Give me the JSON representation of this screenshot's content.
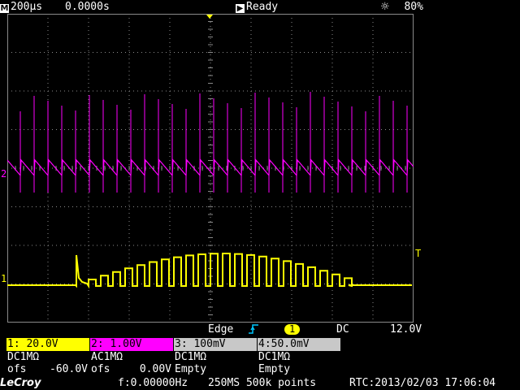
{
  "status": {
    "timebase": "200µs",
    "delay": "0.0000s",
    "run_state": "Ready",
    "brightness": "80%"
  },
  "trigger": {
    "type": "Edge",
    "source": "1",
    "coupling": "DC",
    "level": "12.0V"
  },
  "channels": [
    {
      "header": "1: 20.0V",
      "coupling": "DC1MΩ",
      "ofs_label": "ofs",
      "ofs_value": "-60.0V",
      "color": "#ffff00"
    },
    {
      "header": "2: 1.00V",
      "coupling": "AC1MΩ",
      "ofs_label": "ofs",
      "ofs_value": "0.00V",
      "color": "#ff00ff"
    },
    {
      "header": "3: 100mV",
      "coupling": "DC1MΩ",
      "ofs_label": "Empty",
      "ofs_value": "",
      "color": "#c8c8c8"
    },
    {
      "header": "4:50.0mV",
      "coupling": "DC1MΩ",
      "ofs_label": "Empty",
      "ofs_value": "",
      "color": "#c8c8c8"
    }
  ],
  "markers": {
    "ch1": "1",
    "ch2": "2",
    "trigger_level": "T"
  },
  "bottom": {
    "brand": "LeCroy",
    "frequency": "f:0.00000Hz",
    "sampling": "250MS 500k points",
    "rtc": "RTC:2013/02/03 17:06:04"
  },
  "colors": {
    "ch1": "#ffff00",
    "ch2": "#ff00ff",
    "grid": "#8a8a8a",
    "trigger_icon": "#00c8ff"
  }
}
